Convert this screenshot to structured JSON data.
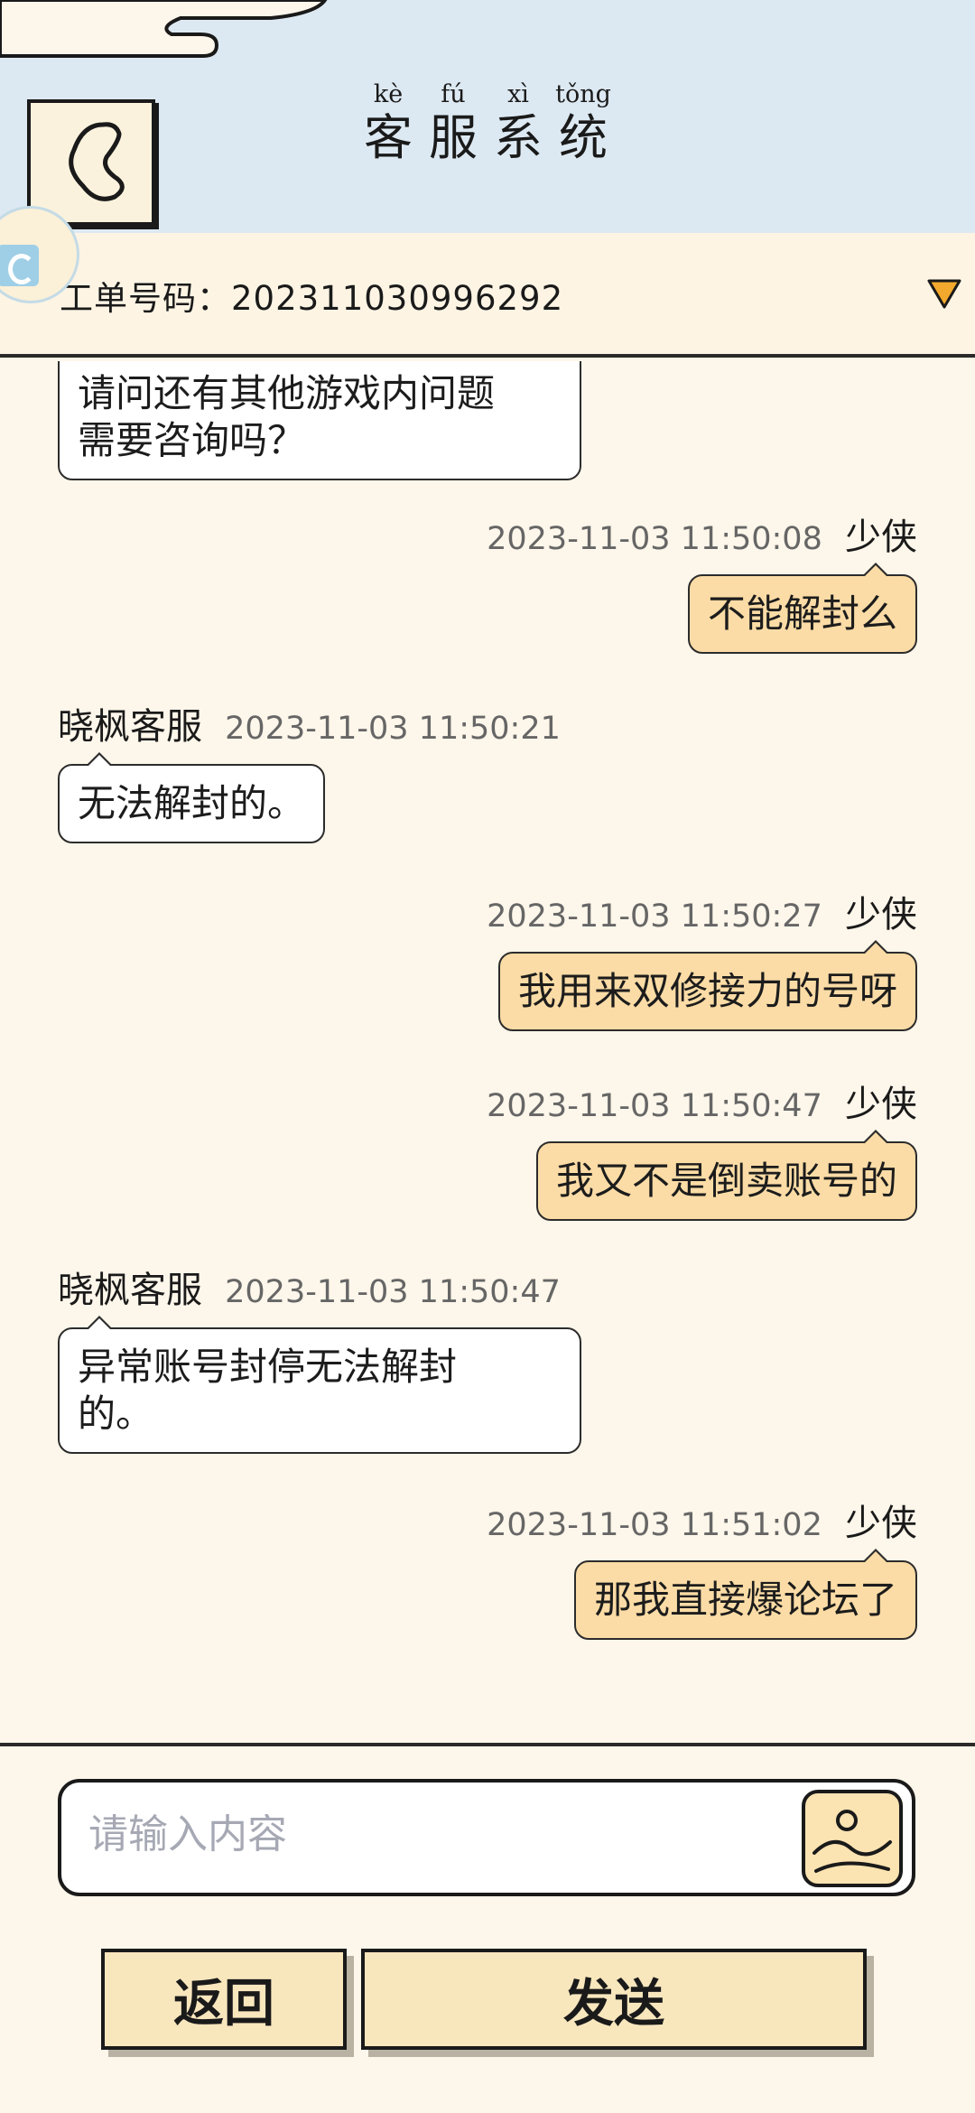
{
  "header": {
    "title_chars": [
      {
        "pinyin": "kè",
        "hanzi": "客"
      },
      {
        "pinyin": "fú",
        "hanzi": "服"
      },
      {
        "pinyin": "xì",
        "hanzi": "系"
      },
      {
        "pinyin": "tǒng",
        "hanzi": "统"
      }
    ]
  },
  "ticket": {
    "text": "工单号码：202311030996292"
  },
  "messages": [
    {
      "side": "cs",
      "text": "请问还有其他游戏内问题需要咨询吗？",
      "lines": [
        "请问还有其他游戏内问题",
        "需要咨询吗？"
      ]
    },
    {
      "side": "user",
      "name": "少侠",
      "time": "2023-11-03 11:50:08",
      "text": "不能解封么"
    },
    {
      "side": "cs",
      "name": "晓枫客服",
      "time": "2023-11-03 11:50:21",
      "text": "无法解封的。"
    },
    {
      "side": "user",
      "name": "少侠",
      "time": "2023-11-03 11:50:27",
      "text": "我用来双修接力的号呀"
    },
    {
      "side": "user",
      "name": "少侠",
      "time": "2023-11-03 11:50:47",
      "text": "我又不是倒卖账号的"
    },
    {
      "side": "cs",
      "name": "晓枫客服",
      "time": "2023-11-03 11:50:47",
      "text": "异常账号封停无法解封的。",
      "lines": [
        "异常账号封停无法解封",
        "的。"
      ]
    },
    {
      "side": "user",
      "name": "少侠",
      "time": "2023-11-03 11:51:02",
      "text": "那我直接爆论坛了"
    }
  ],
  "input": {
    "placeholder": "请输入内容",
    "value": ""
  },
  "buttons": {
    "back_label": "返回",
    "send_label": "发送"
  },
  "colors": {
    "header_bg": "#dde9f2",
    "page_bg": "#fdf6ea",
    "user_bubble": "#fbdca6",
    "cs_bubble": "#ffffff",
    "button_bg": "#f8e6bd",
    "dropdown_accent": "#f3a92d"
  },
  "icons": {
    "back": "chevron-left-heart-icon",
    "dropdown": "triangle-down-icon",
    "image": "image-upload-icon",
    "badge": "floating-app-badge-icon"
  }
}
